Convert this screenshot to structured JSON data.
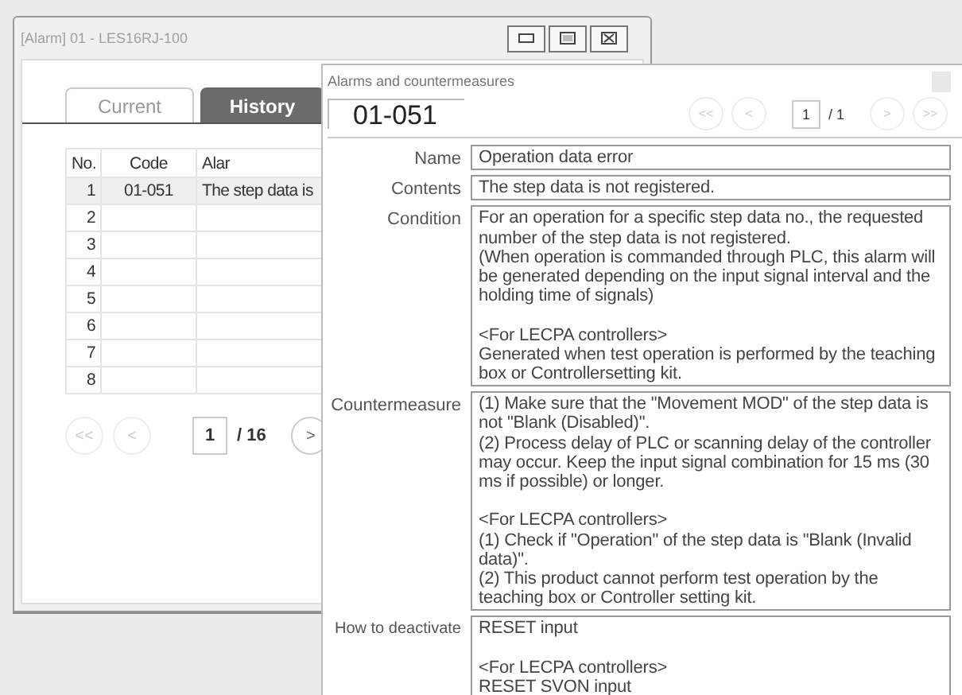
{
  "alarm_window": {
    "title": "[Alarm] 01 - LES16RJ-100",
    "tabs": [
      {
        "label": "Current",
        "selected": false
      },
      {
        "label": "History",
        "selected": true
      }
    ],
    "table": {
      "columns": [
        "No.",
        "Code",
        "Alar"
      ],
      "rows": [
        {
          "cells": [
            "1",
            "01-051",
            "The step data is"
          ],
          "selected": true
        },
        {
          "cells": [
            "2",
            "",
            ""
          ],
          "selected": false
        },
        {
          "cells": [
            "3",
            "",
            ""
          ],
          "selected": false
        },
        {
          "cells": [
            "4",
            "",
            ""
          ],
          "selected": false
        },
        {
          "cells": [
            "5",
            "",
            ""
          ],
          "selected": false
        },
        {
          "cells": [
            "6",
            "",
            ""
          ],
          "selected": false
        },
        {
          "cells": [
            "7",
            "",
            ""
          ],
          "selected": false
        },
        {
          "cells": [
            "8",
            "",
            ""
          ],
          "selected": false
        }
      ]
    },
    "pager": {
      "first": {
        "label": "<<",
        "disabled": true
      },
      "prev": {
        "label": "<",
        "disabled": true
      },
      "page": "1",
      "total": "/ 16",
      "next": {
        "label": ">",
        "disabled": false
      }
    }
  },
  "dialog": {
    "title": "Alarms and countermeasures",
    "code": "01-051",
    "pager": {
      "first": {
        "label": "<<",
        "disabled": true
      },
      "prev": {
        "label": "<",
        "disabled": true
      },
      "page": "1",
      "total": "/ 1",
      "next": {
        "label": ">",
        "disabled": true
      },
      "last": {
        "label": ">>",
        "disabled": true
      }
    },
    "fields": [
      {
        "label": "Name",
        "value": "Operation data error"
      },
      {
        "label": "Contents",
        "value": "The step data is not registered."
      },
      {
        "label": "Condition",
        "value": "For an operation for a specific step data no., the requested number of the step data is not registered.\n(When operation is commanded through PLC, this alarm will be generated depending on the input signal interval and the holding time of signals)\n\n<For LECPA controllers>\nGenerated when test operation is performed by the teaching box or Controllersetting kit."
      },
      {
        "label": "Countermeasure",
        "value": "(1) Make sure that the \"Movement MOD\" of the step data is not \"Blank (Disabled)\".\n(2) Process delay of PLC or scanning delay of the controller may occur. Keep the input signal combination for 15 ms (30 ms if possible) or longer.\n\n<For LECPA controllers>\n(1) Check if \"Operation\" of the step data is \"Blank (Invalid data)\".\n(2) This product cannot perform test operation by the teaching box or Controller setting kit."
      },
      {
        "label": "How to deactivate",
        "value": "RESET input\n\n<For LECPA controllers>\nRESET SVON input"
      }
    ]
  }
}
